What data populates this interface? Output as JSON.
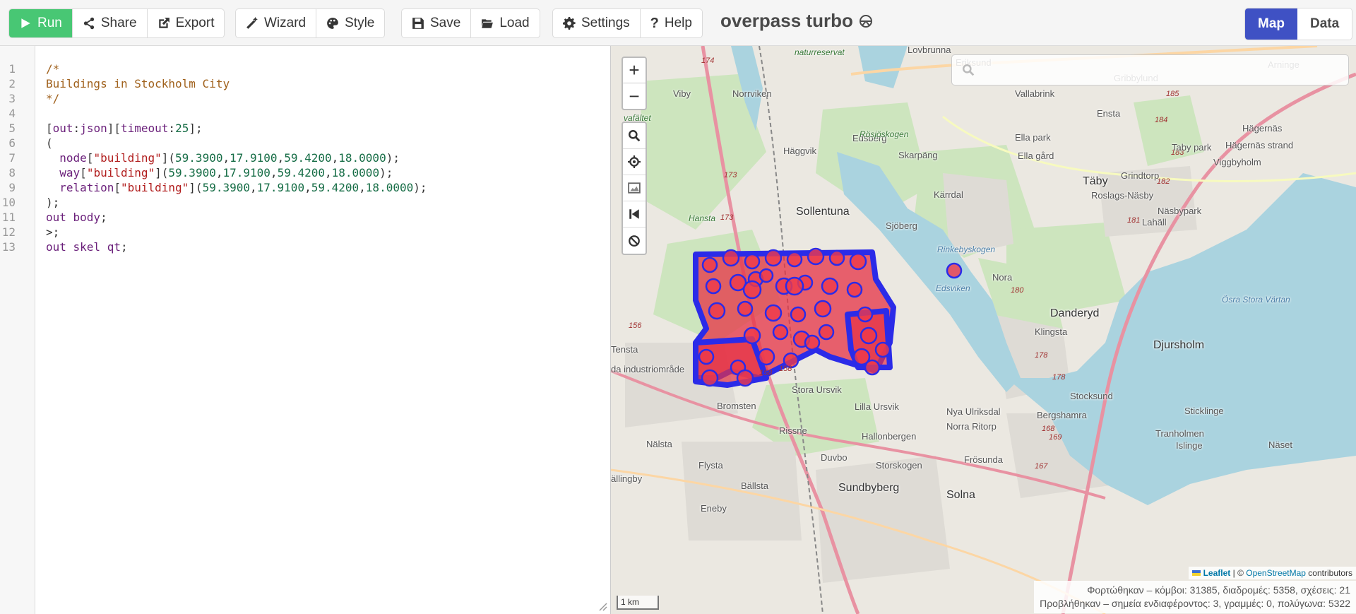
{
  "toolbar": {
    "run": "Run",
    "share": "Share",
    "export": "Export",
    "wizard": "Wizard",
    "style": "Style",
    "save": "Save",
    "load": "Load",
    "settings": "Settings",
    "help": "Help",
    "app_title": "overpass turbo",
    "view_map": "Map",
    "view_data": "Data"
  },
  "editor": {
    "line_numbers": [
      "1",
      "2",
      "3",
      "4",
      "5",
      "6",
      "7",
      "8",
      "9",
      "10",
      "11",
      "12",
      "13"
    ]
  },
  "map": {
    "search_placeholder": "",
    "zoom_in": "+",
    "zoom_out": "−",
    "scale_label": "1 km",
    "attribution": {
      "leaflet": "Leaflet",
      "separator": " | © ",
      "osm": "OpenStreetMap",
      "suffix": " contributors"
    },
    "stats_line1": "Φορτώθηκαν – κόμβοι: 31385, διαδρομές: 5358, σχέσεις: 21",
    "stats_line2": "Προβλήθηκαν – σημεία ενδιαφέροντος: 3, γραμμές: 0, πολύγωνα: 5322",
    "place_labels": [
      "Lovbrunna",
      "naturreservat",
      "Eriksund",
      "Gribbylund",
      "Viby",
      "Norrviken",
      "Vallabrink",
      "Ensta",
      "Hägernäs",
      "vafältet",
      "Edsberg",
      "Rösjöskogen",
      "Ella park",
      "Taby park",
      "Hägernäs strand",
      "Häggvik",
      "Skarpäng",
      "Ella gård",
      "Viggbyholm",
      "Grindtorp",
      "Täby",
      "Roslags-Näsby",
      "Kärrdal",
      "Sollentuna",
      "Näsbypark",
      "Hansta",
      "Sjöberg",
      "Lahäll",
      "Rinkebyskogen",
      "Nora",
      "Edsviken",
      "Danderyd",
      "Klingsta",
      "Djursholm",
      "Tensta",
      "da industriområde",
      "Stora Ursvik",
      "Bromsten",
      "Lilla Ursvik",
      "Nya Ulriksdal",
      "Bergshamra",
      "Stocksund",
      "Sticklinge",
      "Norra Ritorp",
      "Tranholmen",
      "Rissne",
      "Hallonbergen",
      "Nälsta",
      "Duvbo",
      "Näset",
      "Islinge",
      "Flysta",
      "Storskogen",
      "Frösunda",
      "ällingby",
      "Sundbyberg",
      "Bällsta",
      "Solna",
      "Eneby",
      "Ösra Stora Värtan",
      "Arninge"
    ]
  }
}
